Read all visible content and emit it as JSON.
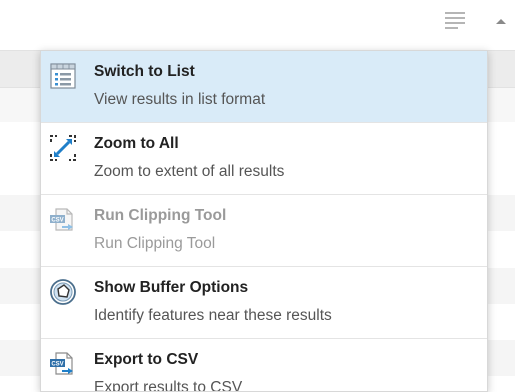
{
  "toolbar": {
    "options_icon": "hamburger-list-icon",
    "collapse_icon": "caret-up-icon"
  },
  "menu": {
    "items": [
      {
        "title": "Switch to List",
        "description": "View results in list format",
        "icon": "list-view-icon",
        "state": "highlighted"
      },
      {
        "title": "Zoom to All",
        "description": "Zoom to extent of all results",
        "icon": "zoom-extent-icon",
        "state": "enabled"
      },
      {
        "title": "Run Clipping Tool",
        "description": "Run Clipping Tool",
        "icon": "csv-clip-icon",
        "state": "disabled"
      },
      {
        "title": "Show Buffer Options",
        "description": "Identify features near these results",
        "icon": "buffer-icon",
        "state": "enabled"
      },
      {
        "title": "Export to CSV",
        "description": "Export results to CSV",
        "icon": "csv-export-icon",
        "state": "enabled"
      }
    ]
  },
  "colors": {
    "highlight": "#d9ebf8",
    "accent_blue": "#1f7fc9",
    "disabled_text": "#9a9a9a"
  }
}
